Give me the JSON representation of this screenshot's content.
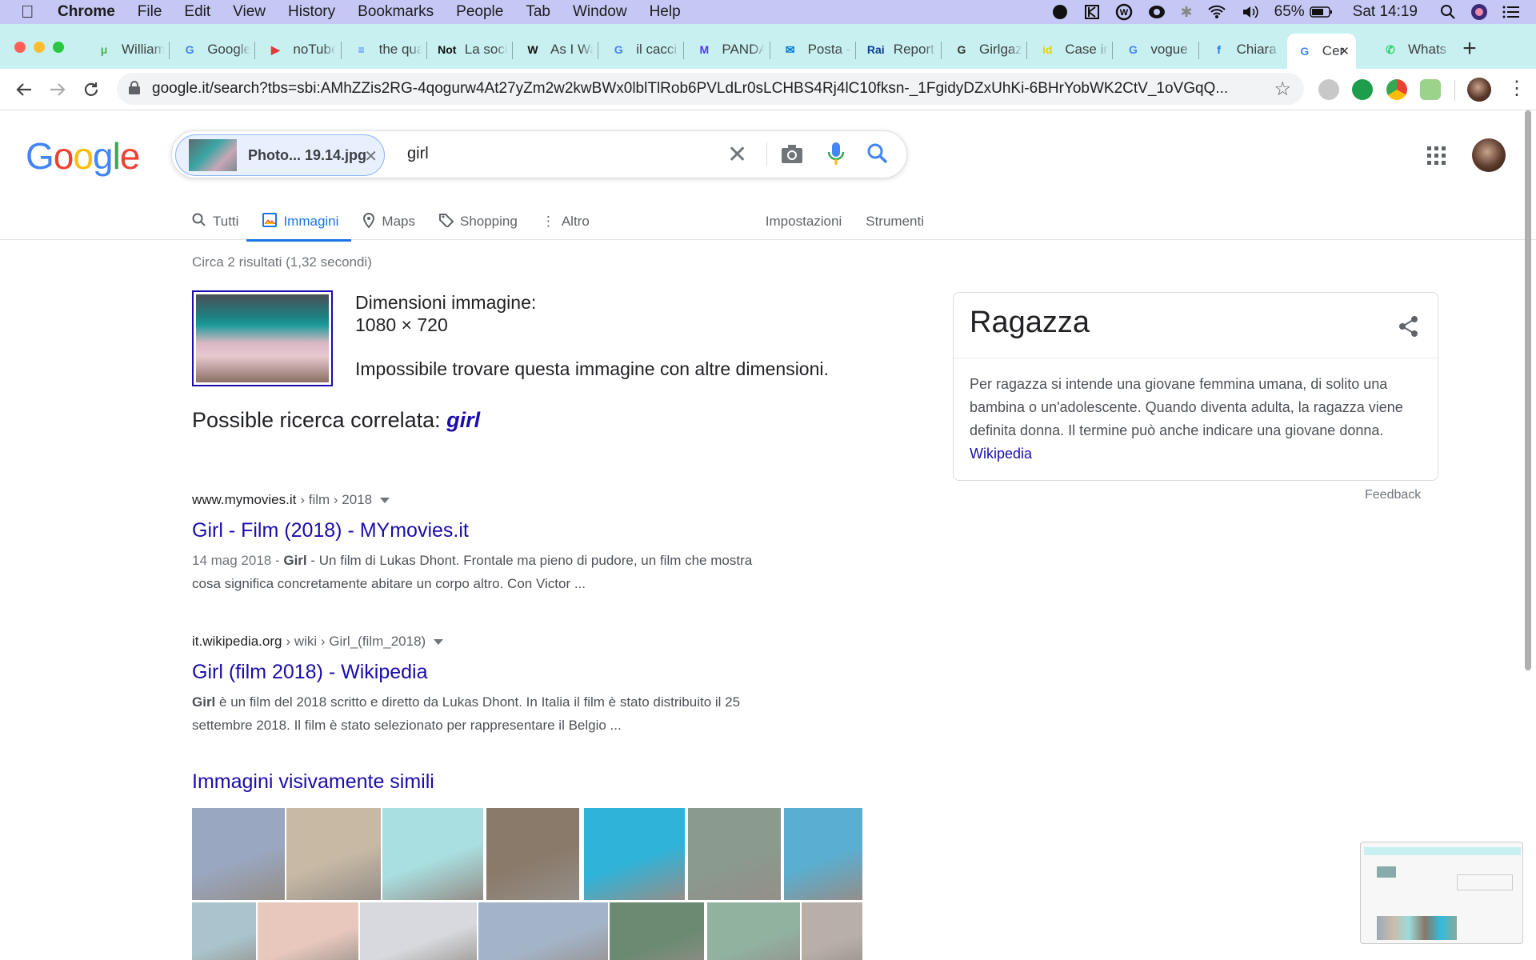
{
  "menubar": {
    "app": "Chrome",
    "items": [
      "File",
      "Edit",
      "View",
      "History",
      "Bookmarks",
      "People",
      "Tab",
      "Window",
      "Help"
    ],
    "battery": "65%",
    "clock": "Sat 14:19"
  },
  "tabs": [
    {
      "title": "William",
      "favicon": "uTorrent",
      "color": "#4caf50"
    },
    {
      "title": "Google",
      "favicon": "G",
      "color": "#4285f4"
    },
    {
      "title": "noTube",
      "favicon": "▶",
      "color": "#e53935"
    },
    {
      "title": "the qua",
      "favicon": "≡",
      "color": "#4285f4"
    },
    {
      "title": "La soci",
      "favicon": "Not",
      "color": "#111"
    },
    {
      "title": "As I Wa",
      "favicon": "W",
      "color": "#111"
    },
    {
      "title": "il cacci",
      "favicon": "G",
      "color": "#4285f4"
    },
    {
      "title": "PANDA",
      "favicon": "M",
      "color": "#4b3cf0"
    },
    {
      "title": "Posta -",
      "favicon": "✉",
      "color": "#0078d4"
    },
    {
      "title": "Report",
      "favicon": "Rai",
      "color": "#0b3d91"
    },
    {
      "title": "Girlgaz",
      "favicon": "G",
      "color": "#333"
    },
    {
      "title": "Case ir",
      "favicon": "id",
      "color": "#e6d200"
    },
    {
      "title": "vogue",
      "favicon": "G",
      "color": "#4285f4"
    },
    {
      "title": "Chiara",
      "favicon": "f",
      "color": "#1877f2"
    },
    {
      "title": "Cer",
      "favicon": "G",
      "color": "#4285f4",
      "active": true
    },
    {
      "title": "Whats",
      "favicon": "✆",
      "color": "#25d366"
    }
  ],
  "address": {
    "url": "google.it/search?tbs=sbi:AMhZZis2RG-4qogurw4At27yZm2w2kwBWx0lblTlRob6PVLdLr0sLCHBS4Rj4lC10fksn-_1FgidyDZxUhKi-6BHrYobWK2CtV_1oVGqQ..."
  },
  "search": {
    "logo": "Google",
    "chip_label": "Photo... 19.14.jpg",
    "query": "girl"
  },
  "nav": {
    "tabs": [
      {
        "label": "Tutti",
        "icon": "search-icon"
      },
      {
        "label": "Immagini",
        "icon": "image-icon",
        "active": true
      },
      {
        "label": "Maps",
        "icon": "pin-icon"
      },
      {
        "label": "Shopping",
        "icon": "tag-icon"
      },
      {
        "label": "Altro",
        "icon": "more-icon"
      }
    ],
    "settings": "Impostazioni",
    "tools": "Strumenti"
  },
  "results": {
    "stats": "Circa 2 risultati (1,32 secondi)",
    "image_dimensions_label": "Dimensioni immagine:",
    "image_dimensions": "1080 × 720",
    "not_found": "Impossibile trovare questa immagine con altre dimensioni.",
    "related_prefix": "Possible ricerca correlata:",
    "related_term": "girl",
    "items": [
      {
        "domain": "www.mymovies.it",
        "path": "› film › 2018",
        "title": "Girl - Film (2018) - MYmovies.it",
        "date": "14 mag 2018 - ",
        "bold": "Girl",
        "snippet1": " - Un film di Lukas Dhont. Frontale ma pieno di pudore, un film che mostra",
        "snippet2": "cosa significa concretamente abitare un corpo altro. Con Victor ..."
      },
      {
        "domain": "it.wikipedia.org",
        "path": "› wiki › Girl_(film_2018)",
        "title": "Girl (film 2018) - Wikipedia",
        "date": "",
        "bold": "Girl",
        "snippet1": " è un film del 2018 scritto e diretto da Lukas Dhont. In Italia il film è stato distribuito il 25",
        "snippet2": "settembre 2018. Il film è stato selezionato per rappresentare il Belgio ..."
      }
    ],
    "similar_title": "Immagini visivamente simili",
    "similar_colors": [
      "#9aa7c0",
      "#c7b9a4",
      "#a9dfe0",
      "#8a7a6a",
      "#2fb3d9",
      "#8a9a8e",
      "#5aaed0",
      "#a9c4cc",
      "#e8c8bd",
      "#d7d9de",
      "#a4b4c8",
      "#6a8a72",
      "#92b2a0",
      "#b8b0a8"
    ]
  },
  "knowledge_panel": {
    "title": "Ragazza",
    "description": "Per ragazza si intende una giovane femmina umana, di solito una bambina o un'adolescente. Quando diventa adulta, la ragazza viene definita donna. Il termine può anche indicare una giovane donna.",
    "source": "Wikipedia",
    "feedback": "Feedback"
  }
}
